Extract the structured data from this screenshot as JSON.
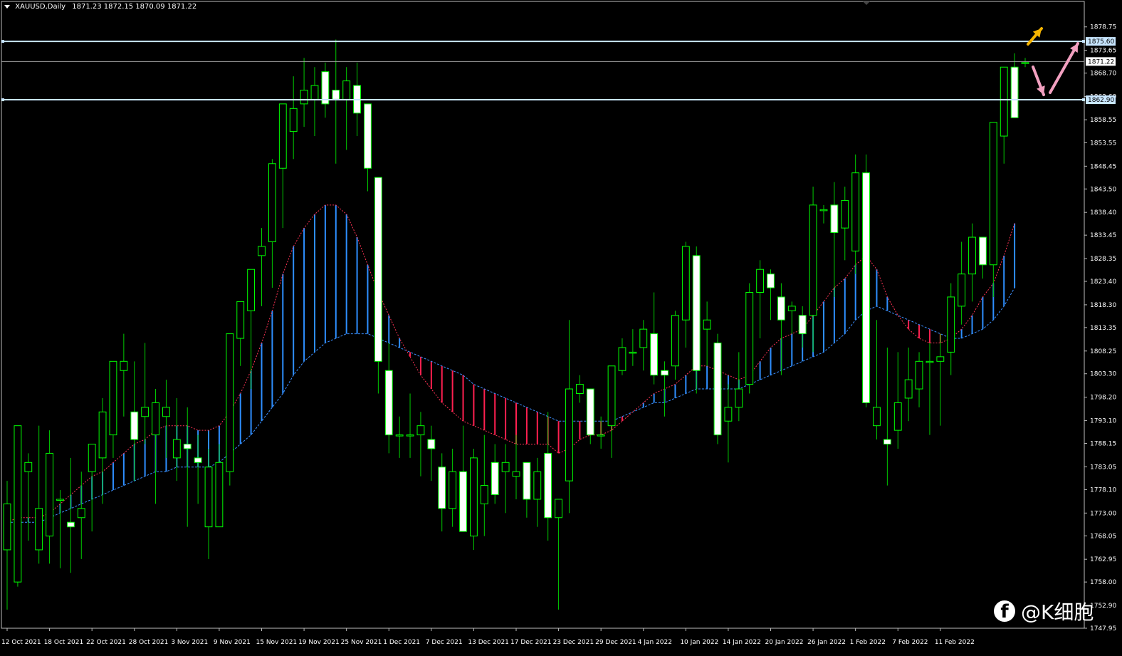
{
  "header": {
    "symbol": "XAUUSD,Daily",
    "ohlc": "1871.23 1872.15 1870.09 1871.22"
  },
  "watermark": {
    "icon": "facebook-icon",
    "text": "@K细胞"
  },
  "colors": {
    "background": "#000000",
    "candle_up_outline": "#00ff00",
    "candle_down_body": "#ffffff",
    "wick": "#00cc00",
    "fast_line": "#ff3355",
    "slow_line": "#3b8fff",
    "cloud_bull": "#2e8fff",
    "cloud_bear": "#ff2050",
    "hline": "#c8e6ff",
    "arrow_yellow": "#f5b400",
    "arrow_pink": "#f2a0c0"
  },
  "chart_data": {
    "type": "candlestick",
    "ylim": [
      1747.95,
      1881.5
    ],
    "y_ticks": [
      "1878.75",
      "1873.65",
      "1868.70",
      "1863.60",
      "1858.55",
      "1853.55",
      "1848.45",
      "1843.50",
      "1838.40",
      "1833.45",
      "1828.35",
      "1823.40",
      "1818.30",
      "1813.35",
      "1808.25",
      "1803.30",
      "1798.20",
      "1793.10",
      "1788.15",
      "1783.05",
      "1778.10",
      "1773.00",
      "1768.05",
      "1762.95",
      "1758.00",
      "1752.90",
      "1747.95"
    ],
    "x_labels": [
      "12 Oct 2021",
      "18 Oct 2021",
      "22 Oct 2021",
      "28 Oct 2021",
      "3 Nov 2021",
      "9 Nov 2021",
      "15 Nov 2021",
      "19 Nov 2021",
      "25 Nov 2021",
      "1 Dec 2021",
      "7 Dec 2021",
      "13 Dec 2021",
      "17 Dec 2021",
      "23 Dec 2021",
      "29 Dec 2021",
      "4 Jan 2022",
      "10 Jan 2022",
      "14 Jan 2022",
      "20 Jan 2022",
      "26 Jan 2022",
      "1 Feb 2022",
      "7 Feb 2022",
      "11 Feb 2022"
    ],
    "price_labels": [
      {
        "label": "1875.60",
        "value": 1875.6,
        "style": "hline"
      },
      {
        "label": "1871.22",
        "value": 1871.22,
        "style": "current"
      },
      {
        "label": "1862.90",
        "value": 1862.9,
        "style": "hline"
      }
    ],
    "candles": [
      [
        1765,
        1780,
        1752,
        1775
      ],
      [
        1758,
        1790,
        1757,
        1792
      ],
      [
        1782,
        1786,
        1767,
        1784
      ],
      [
        1765,
        1792,
        1762,
        1774
      ],
      [
        1768,
        1791,
        1762,
        1786
      ],
      [
        1776,
        1778,
        1761,
        1776
      ],
      [
        1771,
        1785,
        1760,
        1770
      ],
      [
        1772,
        1782,
        1763,
        1774
      ],
      [
        1782,
        1788,
        1769,
        1788
      ],
      [
        1785,
        1798,
        1775,
        1795
      ],
      [
        1790,
        1806,
        1785,
        1806
      ],
      [
        1804,
        1812,
        1794,
        1806
      ],
      [
        1795,
        1806,
        1780,
        1789
      ],
      [
        1794,
        1810,
        1788,
        1796
      ],
      [
        1790,
        1800,
        1775,
        1797
      ],
      [
        1794,
        1802,
        1785,
        1796
      ],
      [
        1785,
        1798,
        1780,
        1789
      ],
      [
        1788,
        1796,
        1770,
        1787
      ],
      [
        1785,
        1790,
        1775,
        1784
      ],
      [
        1770,
        1787,
        1763,
        1783
      ],
      [
        1770,
        1788,
        1770,
        1784
      ],
      [
        1782,
        1812,
        1779,
        1812
      ],
      [
        1811,
        1815,
        1805,
        1819
      ],
      [
        1817,
        1823,
        1800,
        1826
      ],
      [
        1829,
        1835,
        1818,
        1831
      ],
      [
        1832,
        1850,
        1822,
        1849
      ],
      [
        1848,
        1862,
        1835,
        1862
      ],
      [
        1856,
        1868,
        1850,
        1861
      ],
      [
        1862,
        1872,
        1857,
        1865
      ],
      [
        1863,
        1870,
        1855,
        1866
      ],
      [
        1869,
        1871,
        1859,
        1862
      ],
      [
        1865,
        1876,
        1849,
        1863
      ],
      [
        1863,
        1870,
        1852,
        1867
      ],
      [
        1866,
        1871,
        1855,
        1860
      ],
      [
        1862,
        1862,
        1843,
        1848
      ],
      [
        1846,
        1846,
        1799,
        1806
      ],
      [
        1804,
        1810,
        1786,
        1790
      ],
      [
        1790,
        1794,
        1785,
        1790
      ],
      [
        1790,
        1799,
        1785,
        1790
      ],
      [
        1790,
        1795,
        1781,
        1792
      ],
      [
        1789,
        1792,
        1780,
        1787
      ],
      [
        1783,
        1786,
        1769,
        1774
      ],
      [
        1774,
        1787,
        1770,
        1782
      ],
      [
        1782,
        1792,
        1770,
        1769
      ],
      [
        1768,
        1787,
        1765,
        1785
      ],
      [
        1775,
        1790,
        1768,
        1779
      ],
      [
        1784,
        1788,
        1775,
        1777
      ],
      [
        1782,
        1788,
        1773,
        1784
      ],
      [
        1781,
        1790,
        1776,
        1782
      ],
      [
        1784,
        1784,
        1772,
        1776
      ],
      [
        1776,
        1785,
        1770,
        1782
      ],
      [
        1786,
        1795,
        1767,
        1772
      ],
      [
        1772,
        1776,
        1752,
        1776
      ],
      [
        1780,
        1815,
        1773,
        1800
      ],
      [
        1799,
        1803,
        1797,
        1801
      ],
      [
        1800,
        1800,
        1788,
        1790
      ],
      [
        1790,
        1794,
        1787,
        1790
      ],
      [
        1792,
        1805,
        1785,
        1805
      ],
      [
        1804,
        1811,
        1803,
        1809
      ],
      [
        1808,
        1813,
        1805,
        1808
      ],
      [
        1809,
        1815,
        1804,
        1813
      ],
      [
        1812,
        1821,
        1801,
        1803
      ],
      [
        1804,
        1806,
        1794,
        1803
      ],
      [
        1805,
        1817,
        1802,
        1816
      ],
      [
        1815,
        1832,
        1809,
        1831
      ],
      [
        1829,
        1831,
        1799,
        1804
      ],
      [
        1813,
        1819,
        1805,
        1815
      ],
      [
        1810,
        1812,
        1788,
        1790
      ],
      [
        1793,
        1801,
        1784,
        1796
      ],
      [
        1796,
        1808,
        1793,
        1800
      ],
      [
        1801,
        1823,
        1799,
        1821
      ],
      [
        1821,
        1828,
        1811,
        1826
      ],
      [
        1825,
        1826,
        1815,
        1822
      ],
      [
        1820,
        1823,
        1803,
        1815
      ],
      [
        1817,
        1819,
        1812,
        1818
      ],
      [
        1816,
        1818,
        1809,
        1812
      ],
      [
        1816,
        1844,
        1808,
        1840
      ],
      [
        1839,
        1840,
        1836,
        1839
      ],
      [
        1840,
        1845,
        1820,
        1834
      ],
      [
        1835,
        1844,
        1828,
        1841
      ],
      [
        1830,
        1851,
        1825,
        1847
      ],
      [
        1847,
        1851,
        1796,
        1797
      ],
      [
        1792,
        1815,
        1789,
        1796
      ],
      [
        1789,
        1809,
        1779,
        1788
      ],
      [
        1791,
        1808,
        1787,
        1797
      ],
      [
        1798,
        1809,
        1793,
        1802
      ],
      [
        1800,
        1808,
        1796,
        1806
      ],
      [
        1806,
        1810,
        1790,
        1806
      ],
      [
        1806,
        1812,
        1792,
        1807
      ],
      [
        1808,
        1823,
        1803,
        1820
      ],
      [
        1818,
        1832,
        1814,
        1825
      ],
      [
        1825,
        1836,
        1819,
        1833
      ],
      [
        1833,
        1828,
        1824,
        1827
      ],
      [
        1827,
        1845,
        1820,
        1858
      ],
      [
        1855,
        1870,
        1849,
        1870
      ],
      [
        1870,
        1873,
        1859,
        1859
      ],
      [
        1871,
        1872,
        1870,
        1871
      ]
    ],
    "fast_ma": [
      1771,
      1772,
      1772,
      1772,
      1773,
      1775,
      1777,
      1779,
      1781,
      1782,
      1784,
      1786,
      1788,
      1789,
      1791,
      1792,
      1792,
      1792,
      1791,
      1791,
      1792,
      1795,
      1799,
      1804,
      1810,
      1817,
      1825,
      1831,
      1835,
      1838,
      1840,
      1840,
      1838,
      1833,
      1827,
      1821,
      1816,
      1811,
      1807,
      1803,
      1800,
      1797,
      1795,
      1793,
      1792,
      1791,
      1790,
      1789,
      1788,
      1788,
      1788,
      1788,
      1786,
      1787,
      1789,
      1790,
      1790,
      1791,
      1793,
      1795,
      1797,
      1799,
      1800,
      1801,
      1803,
      1805,
      1805,
      1804,
      1803,
      1802,
      1803,
      1806,
      1809,
      1811,
      1812,
      1813,
      1816,
      1819,
      1822,
      1824,
      1827,
      1829,
      1826,
      1820,
      1816,
      1813,
      1811,
      1810,
      1810,
      1811,
      1813,
      1816,
      1820,
      1823,
      1829,
      1836
    ],
    "slow_ma": [
      1771,
      1771,
      1771,
      1771,
      1772,
      1773,
      1774,
      1775,
      1776,
      1777,
      1778,
      1779,
      1780,
      1781,
      1782,
      1782,
      1783,
      1783,
      1783,
      1783,
      1784,
      1786,
      1788,
      1790,
      1793,
      1796,
      1799,
      1803,
      1806,
      1808,
      1810,
      1811,
      1812,
      1812,
      1812,
      1811,
      1810,
      1809,
      1808,
      1807,
      1806,
      1805,
      1804,
      1803,
      1801,
      1800,
      1799,
      1798,
      1797,
      1796,
      1795,
      1794,
      1793,
      1793,
      1793,
      1793,
      1793,
      1793,
      1794,
      1795,
      1796,
      1797,
      1797,
      1798,
      1799,
      1800,
      1800,
      1800,
      1800,
      1800,
      1801,
      1802,
      1803,
      1804,
      1805,
      1806,
      1807,
      1808,
      1810,
      1812,
      1815,
      1817,
      1818,
      1817,
      1816,
      1815,
      1814,
      1813,
      1812,
      1811,
      1811,
      1812,
      1813,
      1815,
      1818,
      1822
    ]
  }
}
